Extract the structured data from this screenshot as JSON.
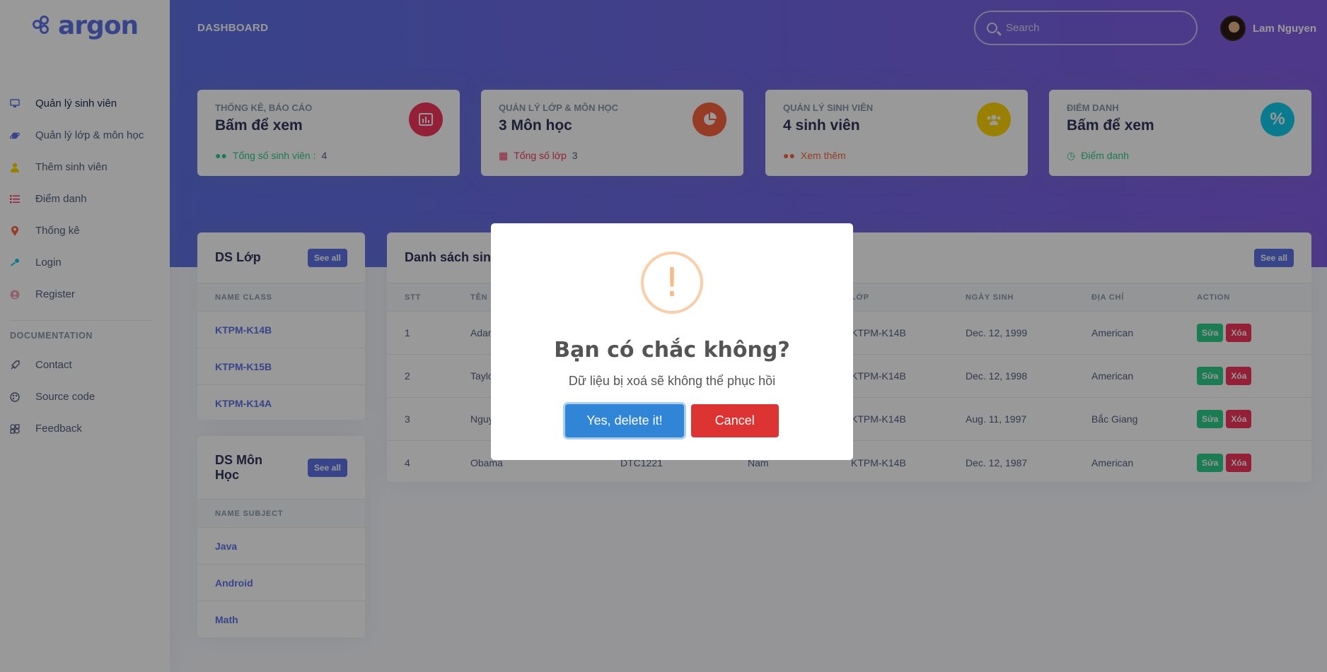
{
  "brand": {
    "name": "argon"
  },
  "sidebar": {
    "items": [
      {
        "label": "Quản lý sinh viên",
        "icon": "monitor-icon",
        "color": "#5e72e4"
      },
      {
        "label": "Quản lý lớp & môn học",
        "icon": "planet-icon",
        "color": "#5e72e4"
      },
      {
        "label": "Thêm sinh viên",
        "icon": "user-icon",
        "color": "#ffd600"
      },
      {
        "label": "Điểm danh",
        "icon": "list-icon",
        "color": "#f5365c"
      },
      {
        "label": "Thống kê",
        "icon": "pin-icon",
        "color": "#fb6340"
      },
      {
        "label": "Login",
        "icon": "key-icon",
        "color": "#11cdef"
      },
      {
        "label": "Register",
        "icon": "circle-user-icon",
        "color": "#f3a4b5"
      }
    ],
    "documentation_heading": "DOCUMENTATION",
    "doc_items": [
      {
        "label": "Contact",
        "icon": "spaceship-icon"
      },
      {
        "label": "Source code",
        "icon": "palette-icon"
      },
      {
        "label": "Feedback",
        "icon": "ui-icon"
      }
    ]
  },
  "header": {
    "title": "DASHBOARD",
    "search_placeholder": "Search",
    "user_name": "Lam Nguyen"
  },
  "stats": [
    {
      "label": "THỐNG KÊ, BÁO CÁO",
      "value": "Bấm để xem",
      "foot_label": "Tổng số sinh viên :",
      "foot_value": "4",
      "foot_color": "#2dce89",
      "icon": "chart-bar-icon",
      "icon_color": "#f5365c"
    },
    {
      "label": "QUẢN LÝ LỚP & MÔN HỌC",
      "value": "3 Môn học",
      "foot_label": "Tổng số lớp",
      "foot_value": "3",
      "foot_color": "#f5365c",
      "icon": "chart-pie-icon",
      "icon_color": "#fb6340"
    },
    {
      "label": "QUẢN LÝ SINH VIÊN",
      "value": "4 sinh viên",
      "foot_label": "Xem thêm",
      "foot_value": "",
      "foot_color": "#fb6340",
      "icon": "users-icon",
      "icon_color": "#ffd600"
    },
    {
      "label": "ĐIỂM DANH",
      "value": "Bấm để xem",
      "foot_label": "Điểm danh",
      "foot_value": "",
      "foot_color": "#2dce89",
      "icon": "percent-icon",
      "icon_color": "#11cdef"
    }
  ],
  "classes_card": {
    "title": "DS Lớp",
    "see_all": "See all",
    "column": "NAME CLASS",
    "rows": [
      "KTPM-K14B",
      "KTPM-K15B",
      "KTPM-K14A"
    ]
  },
  "subjects_card": {
    "title_line1": "DS Môn",
    "title_line2": "Học",
    "see_all": "See all",
    "column": "NAME SUBJECT",
    "rows": [
      "Java",
      "Android",
      "Math"
    ]
  },
  "students_card": {
    "title": "Danh sách sinh",
    "see_all": "See all",
    "columns": [
      "STT",
      "TÊN",
      "LỚP",
      "NGÀY SINH",
      "ĐỊA CHỈ",
      "ACTION"
    ],
    "rows": [
      {
        "stt": "1",
        "name": "Adar",
        "code": "",
        "gender": "",
        "class": "KTPM-K14B",
        "dob": "Dec. 12, 1999",
        "address": "American"
      },
      {
        "stt": "2",
        "name": "Taylo",
        "code": "",
        "gender": "",
        "class": "KTPM-K14B",
        "dob": "Dec. 12, 1998",
        "address": "American"
      },
      {
        "stt": "3",
        "name": "Nguy",
        "code": "",
        "gender": "",
        "class": "KTPM-K14B",
        "dob": "Aug. 11, 1997",
        "address": "Bắc Giang"
      },
      {
        "stt": "4",
        "name": "Obama",
        "code": "DTC1221",
        "gender": "Nam",
        "class": "KTPM-K14B",
        "dob": "Dec. 12, 1987",
        "address": "American"
      }
    ],
    "edit_label": "Sửa",
    "delete_label": "Xóa"
  },
  "modal": {
    "icon_glyph": "!",
    "title": "Bạn có chắc không?",
    "text": "Dữ liệu bị xoá sẽ không thể phục hồi",
    "confirm_label": "Yes, delete it!",
    "cancel_label": "Cancel"
  }
}
